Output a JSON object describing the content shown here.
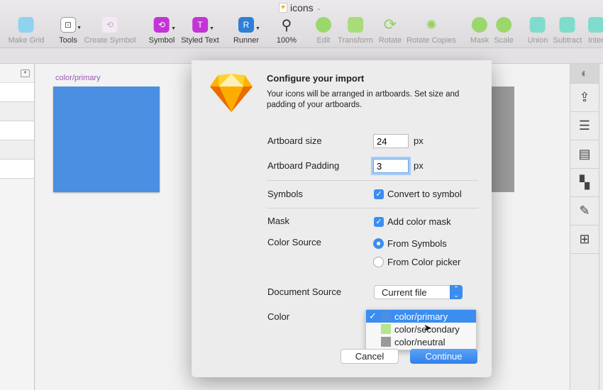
{
  "window": {
    "title": "icons"
  },
  "toolbar": [
    {
      "label": "Make Grid",
      "icon": "grid-icon",
      "disabled": true
    },
    {
      "label": "Tools",
      "icon": "tools-icon"
    },
    {
      "label": "Create Symbol",
      "icon": "create-symbol-icon",
      "disabled": true
    },
    {
      "label": "Symbol",
      "icon": "symbol-icon"
    },
    {
      "label": "Styled Text",
      "icon": "styled-text-icon",
      "glyph": "T"
    },
    {
      "label": "Runner",
      "icon": "runner-icon",
      "glyph": "R"
    },
    {
      "label": "100%",
      "icon": "zoom-icon"
    },
    {
      "label": "Edit",
      "icon": "edit-icon",
      "disabled": true
    },
    {
      "label": "Transform",
      "icon": "transform-icon",
      "disabled": true
    },
    {
      "label": "Rotate",
      "icon": "rotate-icon",
      "disabled": true
    },
    {
      "label": "Rotate Copies",
      "icon": "rotate-copies-icon",
      "disabled": true
    },
    {
      "label": "Mask",
      "icon": "mask-icon",
      "disabled": true
    },
    {
      "label": "Scale",
      "icon": "scale-icon",
      "disabled": true
    },
    {
      "label": "Union",
      "icon": "union-icon",
      "disabled": true
    },
    {
      "label": "Subtract",
      "icon": "subtract-icon",
      "disabled": true
    },
    {
      "label": "Inter",
      "icon": "intersect-icon",
      "disabled": true
    }
  ],
  "canvas": {
    "artboard_label": "color/primary",
    "artboard_color": "#4a8fe2"
  },
  "dialog": {
    "title": "Configure your import",
    "description": "Your icons will be arranged in artboards. Set size and padding of your artboards.",
    "artboard_size_label": "Artboard size",
    "artboard_size": "24",
    "unit": "px",
    "artboard_padding_label": "Artboard Padding",
    "artboard_padding": "3",
    "symbols_label": "Symbols",
    "convert_label": "Convert to symbol",
    "convert_checked": true,
    "mask_label": "Mask",
    "mask_option": "Add color mask",
    "mask_checked": true,
    "color_source_label": "Color Source",
    "color_source_options": [
      "From Symbols",
      "From Color picker"
    ],
    "color_source_selected": "From Symbols",
    "document_source_label": "Document Source",
    "document_source": "Current file",
    "color_label": "Color",
    "color_options": [
      {
        "label": "color/primary",
        "swatch": "#4a8fe2",
        "selected": true
      },
      {
        "label": "color/secondary",
        "swatch": "#b4e68a"
      },
      {
        "label": "color/neutral",
        "swatch": "#9a9a9a"
      }
    ],
    "cancel": "Cancel",
    "continue": "Continue"
  }
}
